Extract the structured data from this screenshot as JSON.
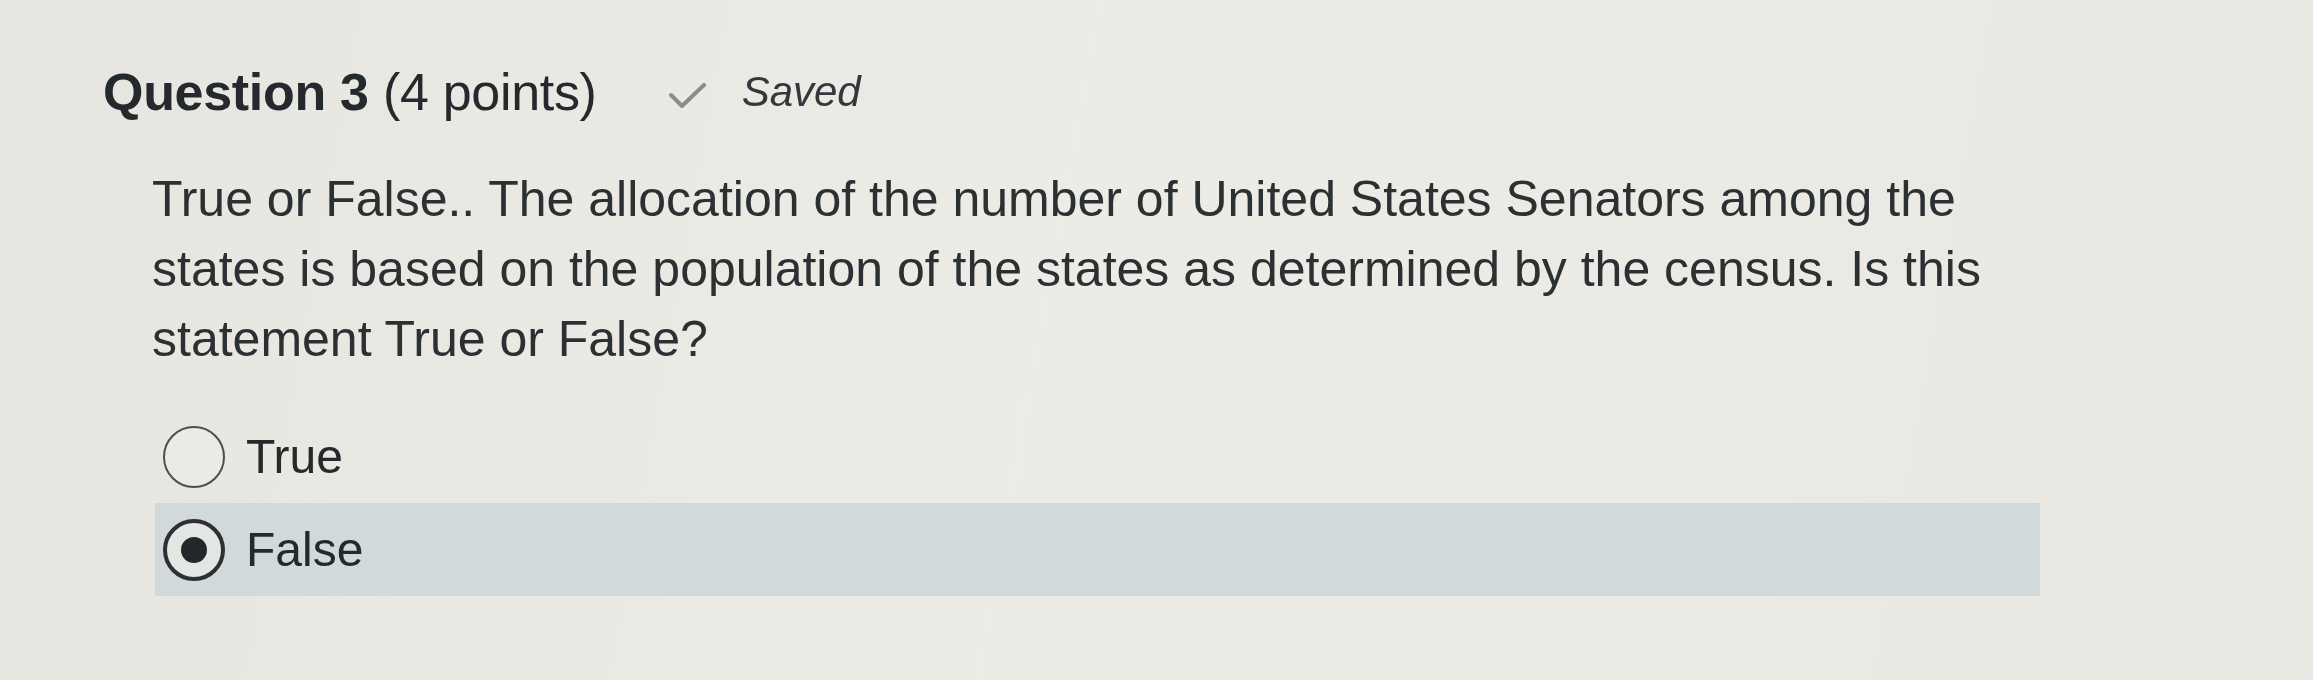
{
  "question": {
    "title": "Question 3",
    "points": "(4 points)",
    "status": "Saved",
    "text": "True or False.. The allocation of the number of United States Senators among the states is based on the population of the states as determined by the census. Is this statement True or False?"
  },
  "options": [
    {
      "label": "True",
      "selected": false
    },
    {
      "label": "False",
      "selected": true
    }
  ]
}
